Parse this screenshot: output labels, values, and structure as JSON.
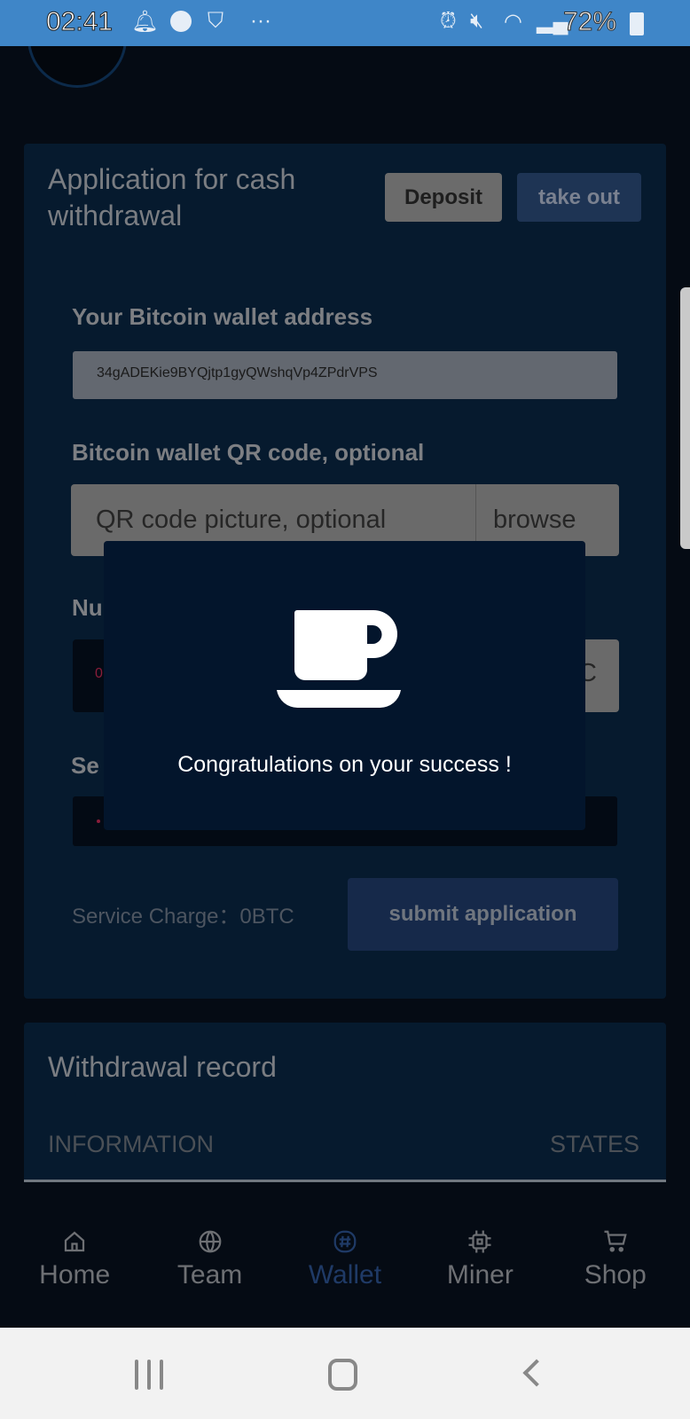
{
  "status_bar": {
    "time": "02:41",
    "battery": "72%",
    "icons": [
      "bell-icon",
      "messenger-icon",
      "shield-icon",
      "more-icon",
      "alarm-icon",
      "mute-icon",
      "wifi-icon",
      "signal-icon",
      "battery-icon"
    ],
    "color": "#3f86c8"
  },
  "withdraw_card": {
    "title": "Application for cash withdrawal",
    "deposit_label": "Deposit",
    "take_out_label": "take out",
    "wallet_label": "Your Bitcoin wallet address",
    "wallet_value": "34gADEKie9BYQjtp1gyQWshqVp4ZPdrVPS",
    "qr_label": "Bitcoin wallet QR code, optional",
    "qr_placeholder": "QR code picture, optional",
    "browse_label": "browse",
    "number_label_partial": "Nu",
    "number_value_partial": "0",
    "number_addon_partial": "C",
    "security_label_partial": "Se",
    "service_charge": "Service Charge：0BTC",
    "submit_label": "submit application"
  },
  "record_card": {
    "title": "Withdrawal record",
    "columns": [
      "INFORMATION",
      "STATES"
    ]
  },
  "modal": {
    "icon": "coffee-cup-icon",
    "message": "Congratulations on your success !"
  },
  "bottom_nav": {
    "active": "Wallet",
    "active_color": "#1f3a66",
    "items": [
      {
        "label": "Home",
        "icon": "home-icon"
      },
      {
        "label": "Team",
        "icon": "globe-icon"
      },
      {
        "label": "Wallet",
        "icon": "wallet-hash-icon"
      },
      {
        "label": "Miner",
        "icon": "chip-icon"
      },
      {
        "label": "Shop",
        "icon": "cart-icon"
      }
    ]
  }
}
